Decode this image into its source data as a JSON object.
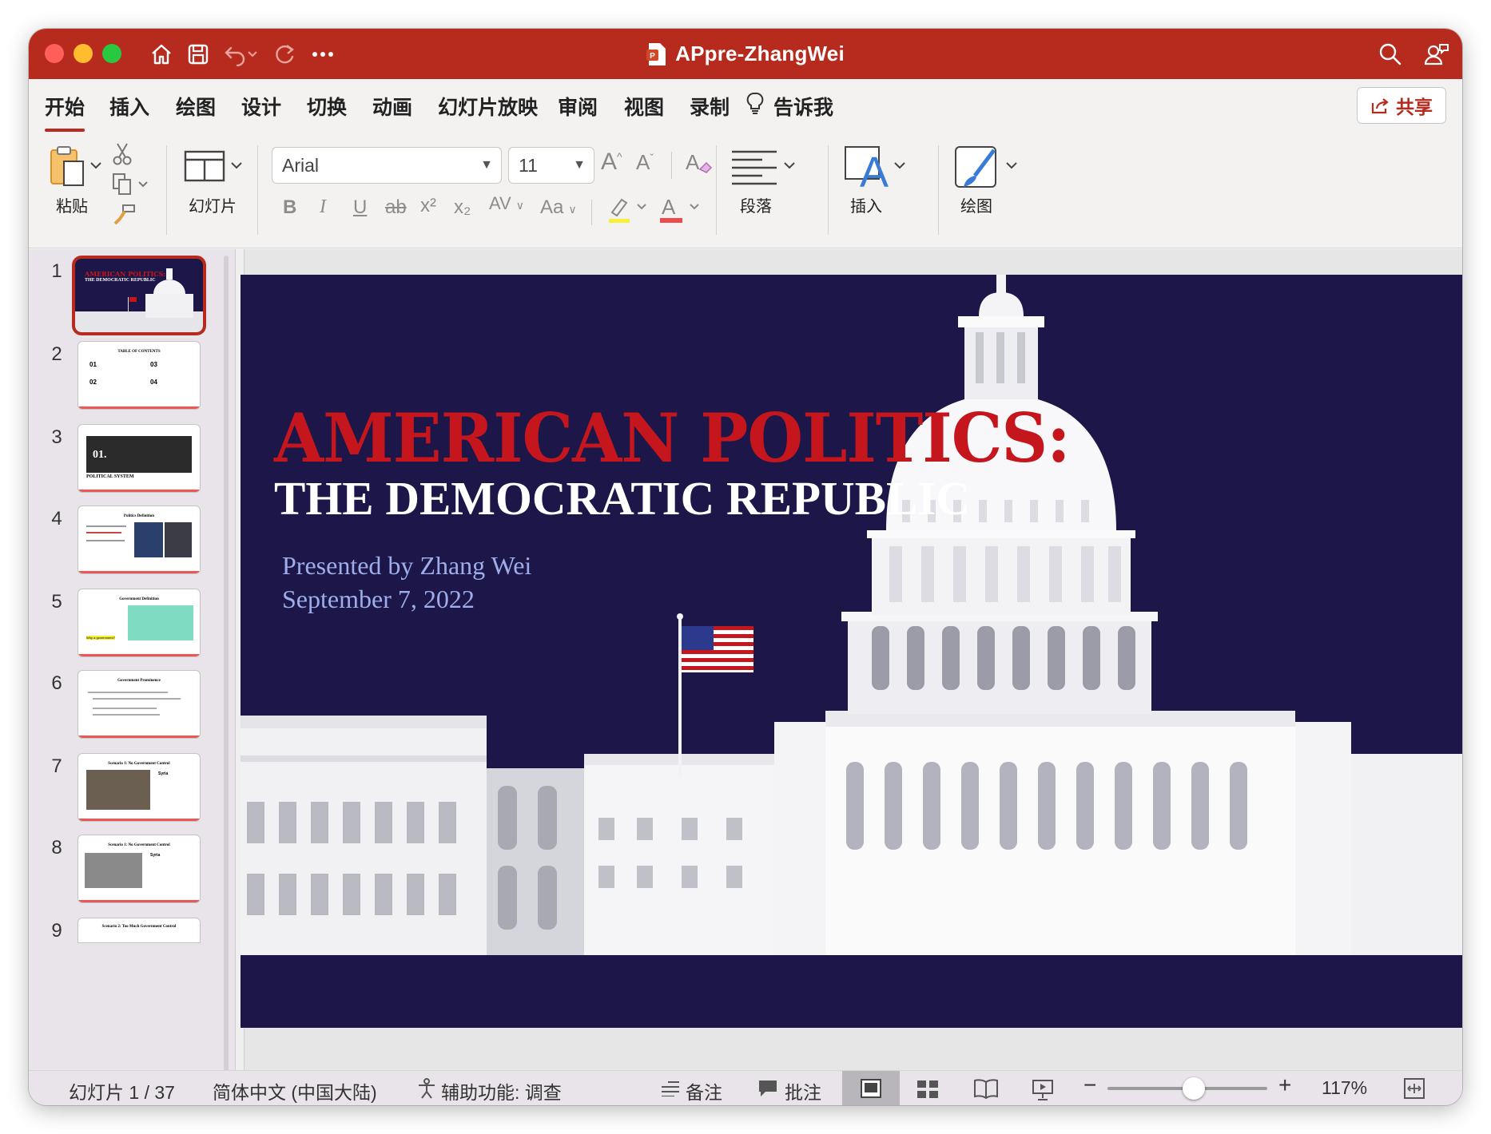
{
  "window": {
    "title": "APpre-ZhangWei",
    "colors": {
      "accent": "#b62b1d",
      "slide_bg": "#1d1749",
      "title_red": "#c4161c",
      "meta_blue": "#9eaeea"
    }
  },
  "tabs": [
    {
      "label": "开始",
      "active": true
    },
    {
      "label": "插入"
    },
    {
      "label": "绘图"
    },
    {
      "label": "设计"
    },
    {
      "label": "切换"
    },
    {
      "label": "动画"
    },
    {
      "label": "幻灯片放映"
    },
    {
      "label": "审阅"
    },
    {
      "label": "视图"
    },
    {
      "label": "录制"
    },
    {
      "label": "告诉我"
    }
  ],
  "share": {
    "label": "共享"
  },
  "ribbon": {
    "paste_label": "粘贴",
    "slide_label": "幻灯片",
    "font_name": "Arial",
    "font_size": "11",
    "paragraph_label": "段落",
    "insert_label": "插入",
    "draw_label": "绘图",
    "format_buttons": [
      "B",
      "I",
      "U",
      "ab",
      "x²",
      "x₂",
      "AV",
      "Aa"
    ]
  },
  "thumbnails": [
    {
      "num": "1",
      "heading": "AMERICAN POLITICS:",
      "sub": "THE DEMOCRATIC REPUBLIC"
    },
    {
      "num": "2",
      "heading": "TABLE OF CONTENTS",
      "items": [
        "01",
        "02",
        "03",
        "04"
      ]
    },
    {
      "num": "3",
      "heading": "01.",
      "sub": "POLITICAL SYSTEM"
    },
    {
      "num": "4",
      "heading": "Politics Definition"
    },
    {
      "num": "5",
      "heading": "Government Definition",
      "highlight": "Why a government?"
    },
    {
      "num": "6",
      "heading": "Government Prominence"
    },
    {
      "num": "7",
      "heading": "Scenario 1: No Government Control",
      "label": "Syria"
    },
    {
      "num": "8",
      "heading": "Scenario 1: No Government Control",
      "label": "Syria"
    },
    {
      "num": "9",
      "heading": "Scenario 2: Too Much Government Control"
    }
  ],
  "slide": {
    "title": "AMERICAN POLITICS:",
    "subtitle": "THE DEMOCRATIC REPUBLIC",
    "presenter": "Presented by Zhang Wei",
    "date": "September 7, 2022"
  },
  "status": {
    "slide_counter": "幻灯片 1 / 37",
    "language": "简体中文 (中国大陆)",
    "accessibility": "辅助功能: 调查",
    "notes": "备注",
    "comments": "批注",
    "zoom": "117%"
  }
}
